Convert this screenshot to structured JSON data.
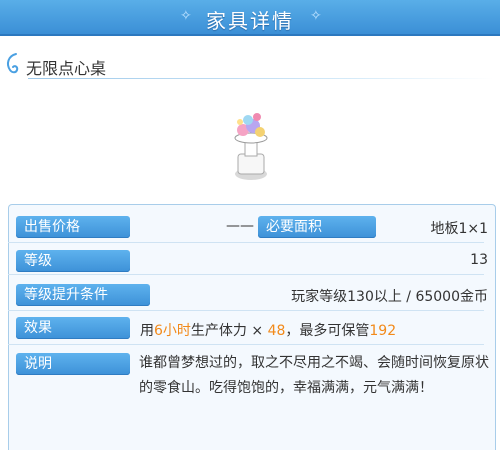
{
  "header": {
    "title": "家具详情"
  },
  "item": {
    "name": "无限点心桌"
  },
  "info": {
    "sell_price_label": "出售价格",
    "sell_price_value": "——",
    "area_label": "必要面积",
    "area_value": "地板1×1",
    "level_label": "等级",
    "level_value": "13",
    "upgrade_label": "等级提升条件",
    "upgrade_value": "玩家等级130以上 / 65000金币",
    "effect_label": "效果",
    "effect_prefix": "用",
    "effect_hours": "6小时",
    "effect_mid": "生产体力 × ",
    "effect_amount": "48",
    "effect_mid2": "，最多可保管",
    "effect_max": "192",
    "desc_label": "说明",
    "description": "谁都曾梦想过的，取之不尽用之不竭、会随时间恢复原状的零食山。吃得饱饱的，幸福满满，元气满满！"
  },
  "colors": {
    "header": "#3b8fd6",
    "label_bg": "#4aa0e2",
    "highlight": "#f28a1a"
  }
}
